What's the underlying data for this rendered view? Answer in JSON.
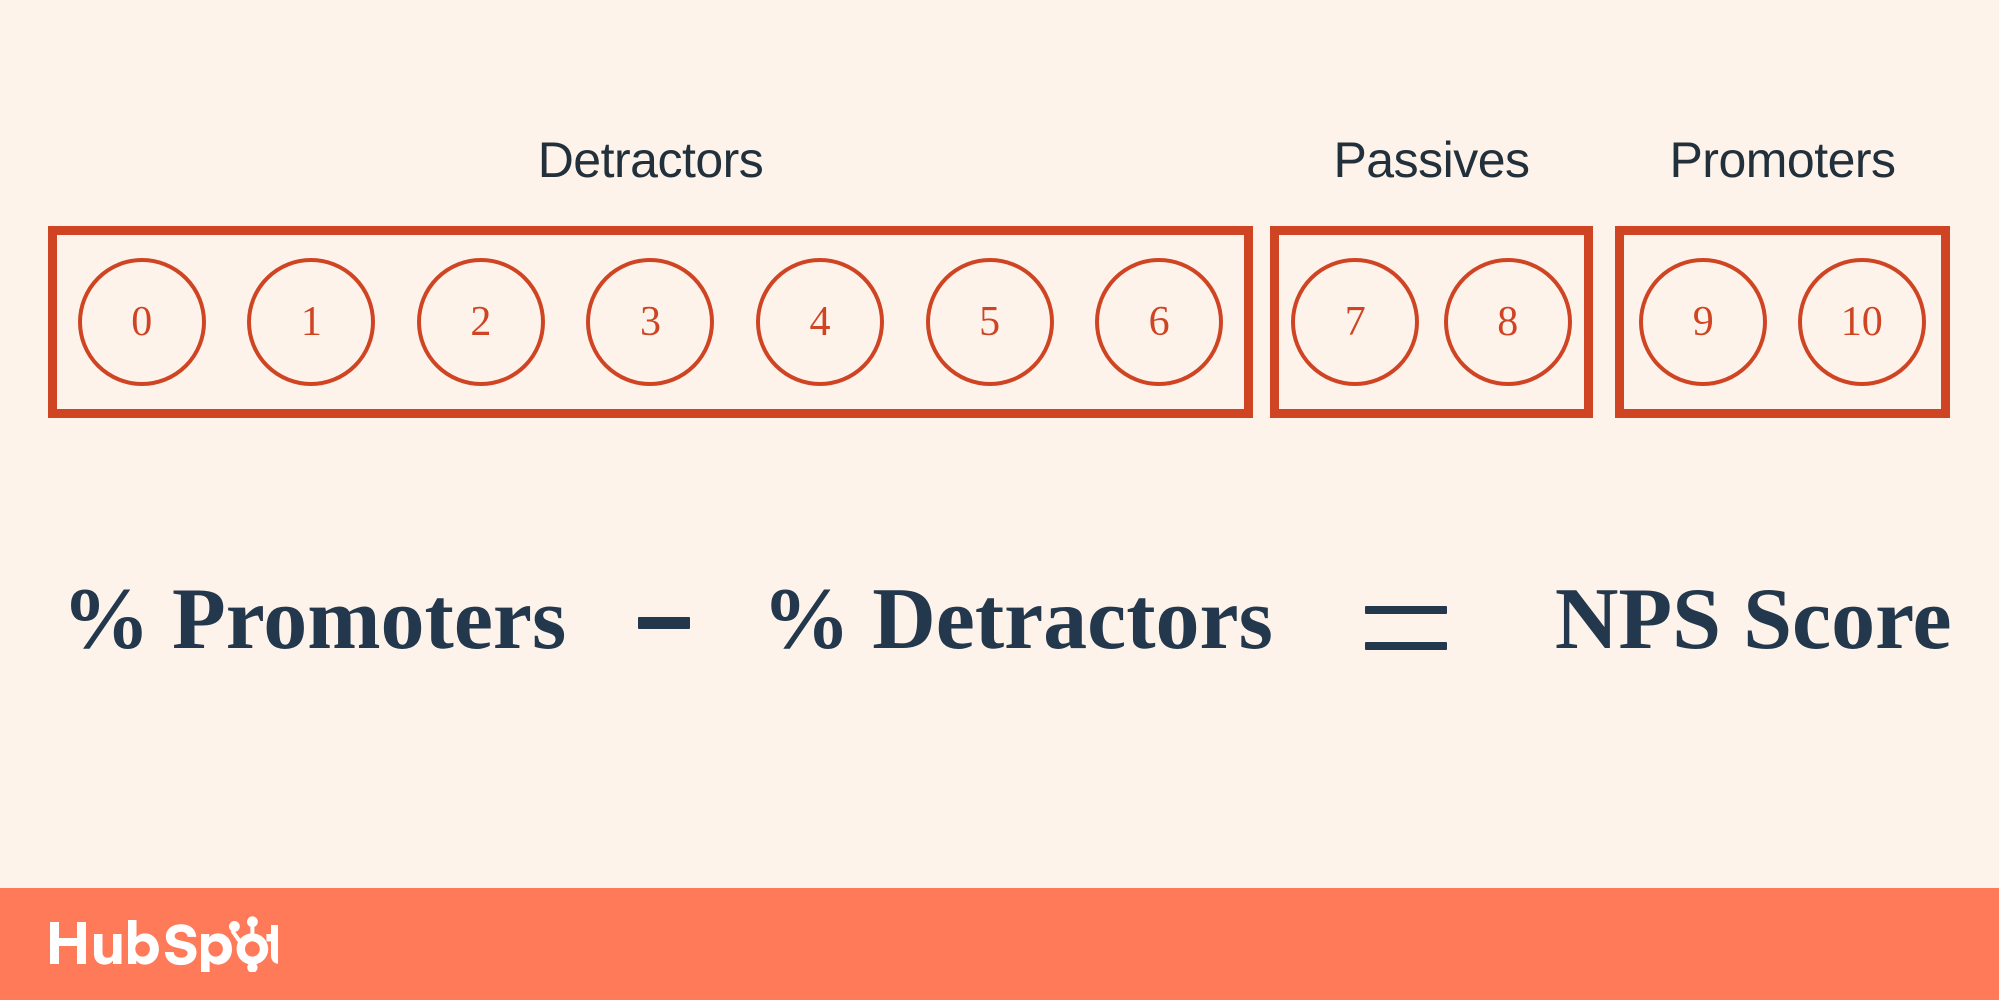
{
  "background_color": "#FDF3EA",
  "accent_color": "#CF4524",
  "text_color": "#23384C",
  "footer_color": "#FF7A59",
  "scale": {
    "groups": [
      {
        "label": "Detractors",
        "scores": [
          "0",
          "1",
          "2",
          "3",
          "4",
          "5",
          "6"
        ]
      },
      {
        "label": "Passives",
        "scores": [
          "7",
          "8"
        ]
      },
      {
        "label": "Promoters",
        "scores": [
          "9",
          "10"
        ]
      }
    ]
  },
  "formula": {
    "term_1": "% Promoters",
    "operator_1": "–",
    "term_2": "% Detractors",
    "operator_2": "=",
    "result": "NPS Score"
  },
  "footer": {
    "brand": "HubSpot"
  }
}
